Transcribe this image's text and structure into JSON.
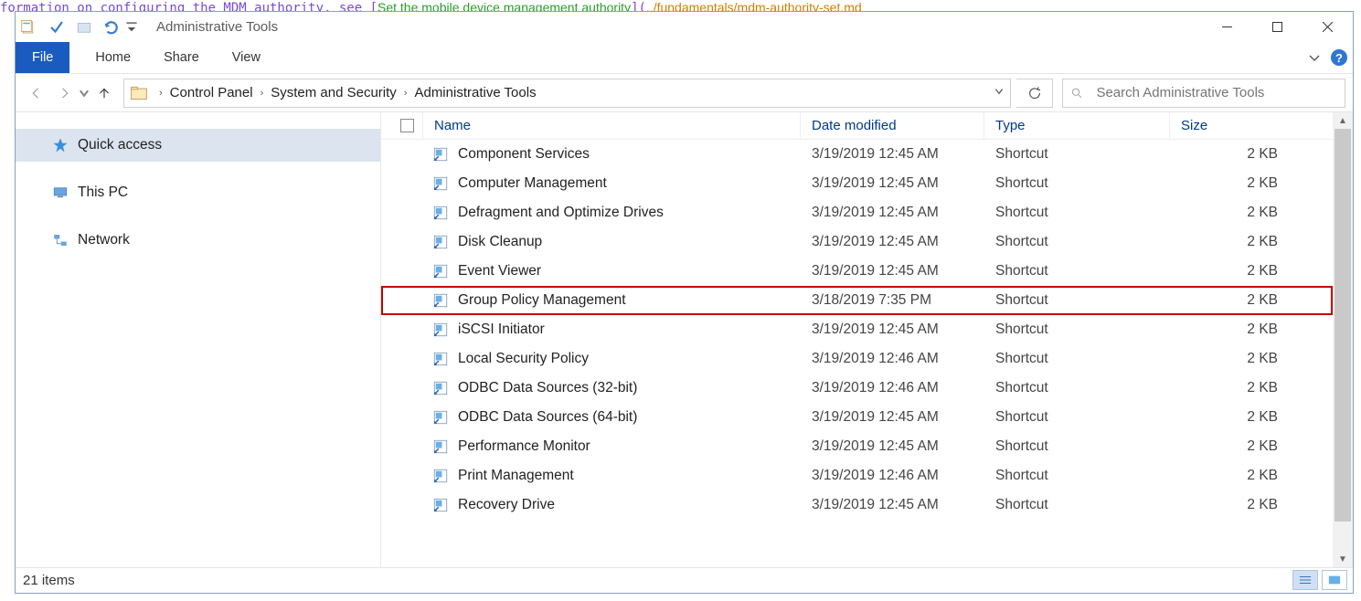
{
  "window_title": "Administrative Tools",
  "ribbon_tabs": {
    "file": "File",
    "home": "Home",
    "share": "Share",
    "view": "View"
  },
  "breadcrumb": [
    "Control Panel",
    "System and Security",
    "Administrative Tools"
  ],
  "search": {
    "placeholder": "Search Administrative Tools"
  },
  "sidebar": {
    "quick_access": "Quick access",
    "this_pc": "This PC",
    "network": "Network"
  },
  "columns": {
    "name": "Name",
    "date": "Date modified",
    "type": "Type",
    "size": "Size"
  },
  "files": [
    {
      "name": "Component Services",
      "date": "3/19/2019 12:45 AM",
      "type": "Shortcut",
      "size": "2 KB",
      "hl": false
    },
    {
      "name": "Computer Management",
      "date": "3/19/2019 12:45 AM",
      "type": "Shortcut",
      "size": "2 KB",
      "hl": false
    },
    {
      "name": "Defragment and Optimize Drives",
      "date": "3/19/2019 12:45 AM",
      "type": "Shortcut",
      "size": "2 KB",
      "hl": false
    },
    {
      "name": "Disk Cleanup",
      "date": "3/19/2019 12:45 AM",
      "type": "Shortcut",
      "size": "2 KB",
      "hl": false
    },
    {
      "name": "Event Viewer",
      "date": "3/19/2019 12:45 AM",
      "type": "Shortcut",
      "size": "2 KB",
      "hl": false
    },
    {
      "name": "Group Policy Management",
      "date": "3/18/2019 7:35 PM",
      "type": "Shortcut",
      "size": "2 KB",
      "hl": true
    },
    {
      "name": "iSCSI Initiator",
      "date": "3/19/2019 12:45 AM",
      "type": "Shortcut",
      "size": "2 KB",
      "hl": false
    },
    {
      "name": "Local Security Policy",
      "date": "3/19/2019 12:46 AM",
      "type": "Shortcut",
      "size": "2 KB",
      "hl": false
    },
    {
      "name": "ODBC Data Sources (32-bit)",
      "date": "3/19/2019 12:46 AM",
      "type": "Shortcut",
      "size": "2 KB",
      "hl": false
    },
    {
      "name": "ODBC Data Sources (64-bit)",
      "date": "3/19/2019 12:45 AM",
      "type": "Shortcut",
      "size": "2 KB",
      "hl": false
    },
    {
      "name": "Performance Monitor",
      "date": "3/19/2019 12:45 AM",
      "type": "Shortcut",
      "size": "2 KB",
      "hl": false
    },
    {
      "name": "Print Management",
      "date": "3/19/2019 12:46 AM",
      "type": "Shortcut",
      "size": "2 KB",
      "hl": false
    },
    {
      "name": "Recovery Drive",
      "date": "3/19/2019 12:45 AM",
      "type": "Shortcut",
      "size": "2 KB",
      "hl": false
    }
  ],
  "status": "21 items"
}
